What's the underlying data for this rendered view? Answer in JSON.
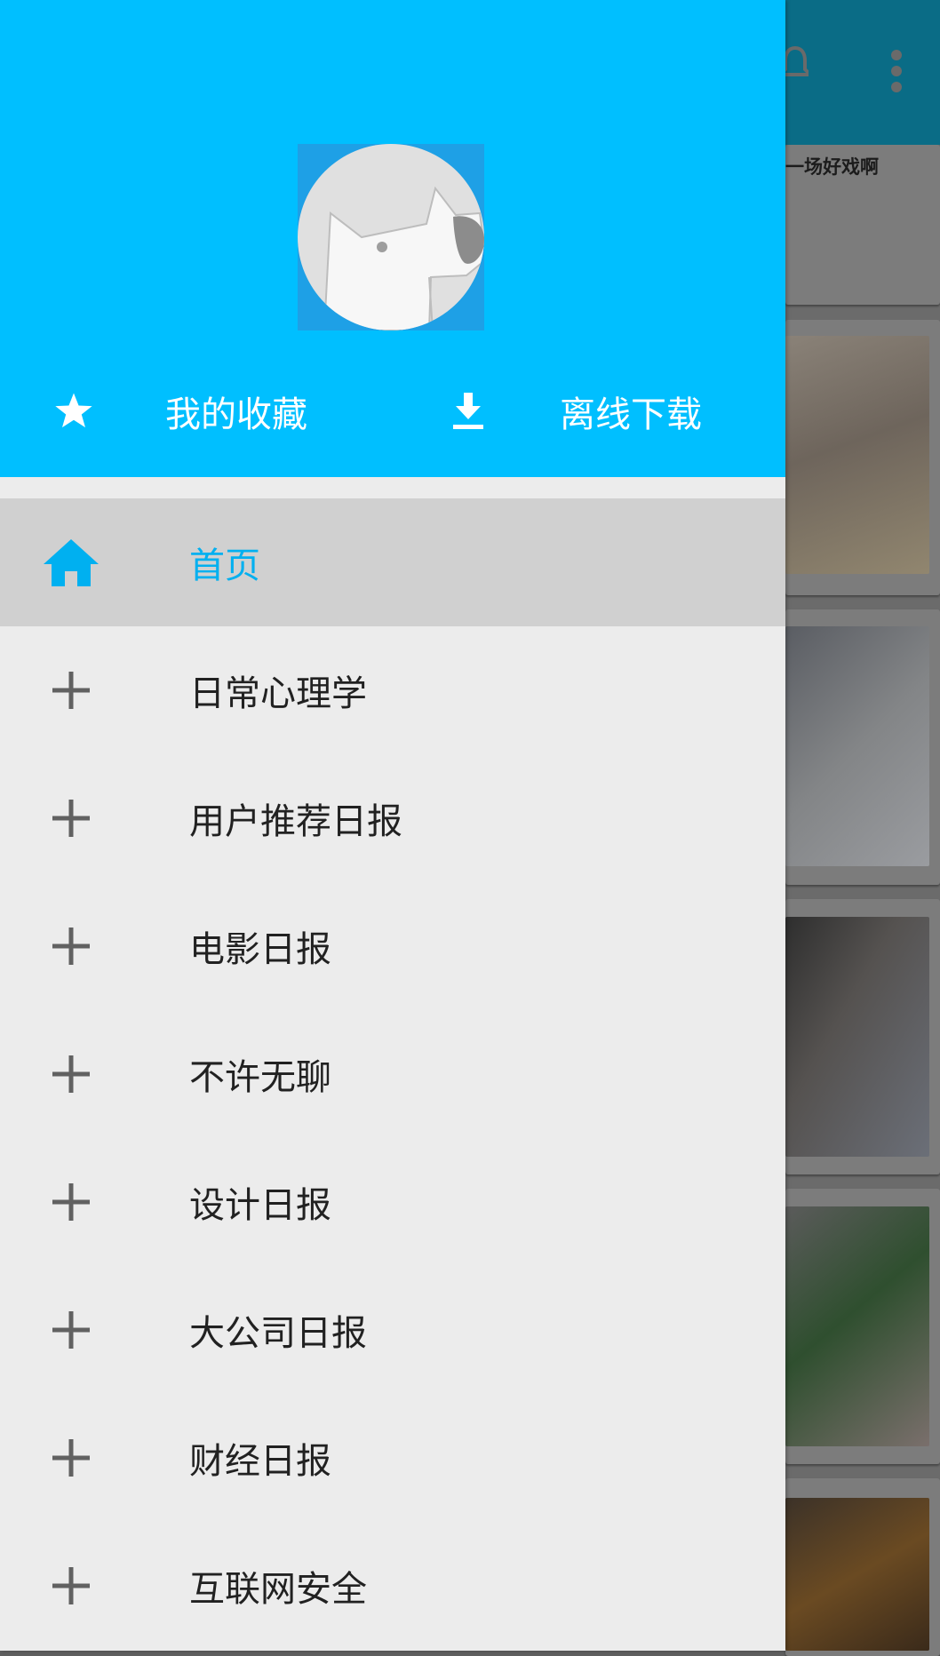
{
  "background": {
    "peek_card_text": "一场好戏啊",
    "icons": [
      "notifications-icon",
      "more-vert-icon"
    ]
  },
  "drawer": {
    "header": {
      "avatar": "avatar-dog",
      "favorites_label": "我的收藏",
      "download_label": "离线下载"
    },
    "menu": [
      {
        "label": "首页",
        "icon": "home-icon",
        "active": true
      },
      {
        "label": "日常心理学",
        "icon": "plus-icon",
        "active": false
      },
      {
        "label": "用户推荐日报",
        "icon": "plus-icon",
        "active": false
      },
      {
        "label": "电影日报",
        "icon": "plus-icon",
        "active": false
      },
      {
        "label": "不许无聊",
        "icon": "plus-icon",
        "active": false
      },
      {
        "label": "设计日报",
        "icon": "plus-icon",
        "active": false
      },
      {
        "label": "大公司日报",
        "icon": "plus-icon",
        "active": false
      },
      {
        "label": "财经日报",
        "icon": "plus-icon",
        "active": false
      },
      {
        "label": "互联网安全",
        "icon": "plus-icon",
        "active": false
      }
    ]
  },
  "colors": {
    "accent": "#00bfff",
    "active_row": "#d0d0d0",
    "drawer_bg": "#ececec"
  }
}
